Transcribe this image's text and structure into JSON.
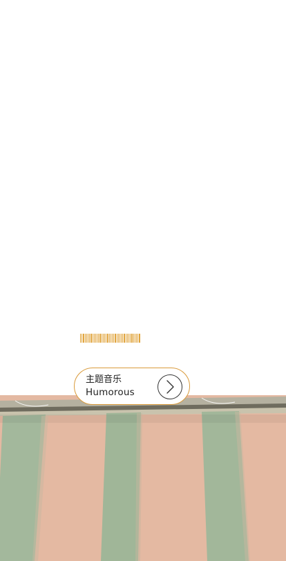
{
  "music_card": {
    "title": "主题音乐",
    "track": "Humorous",
    "next_icon": "chevron-right-icon"
  },
  "waveform": {
    "icon": "audio-waveform-icon",
    "color": "#e0a33a"
  },
  "colors": {
    "accent": "#d99a3a",
    "stripe_pink": "#e2b7a0",
    "stripe_green": "#9fb598",
    "rim": "#8d8a78"
  }
}
